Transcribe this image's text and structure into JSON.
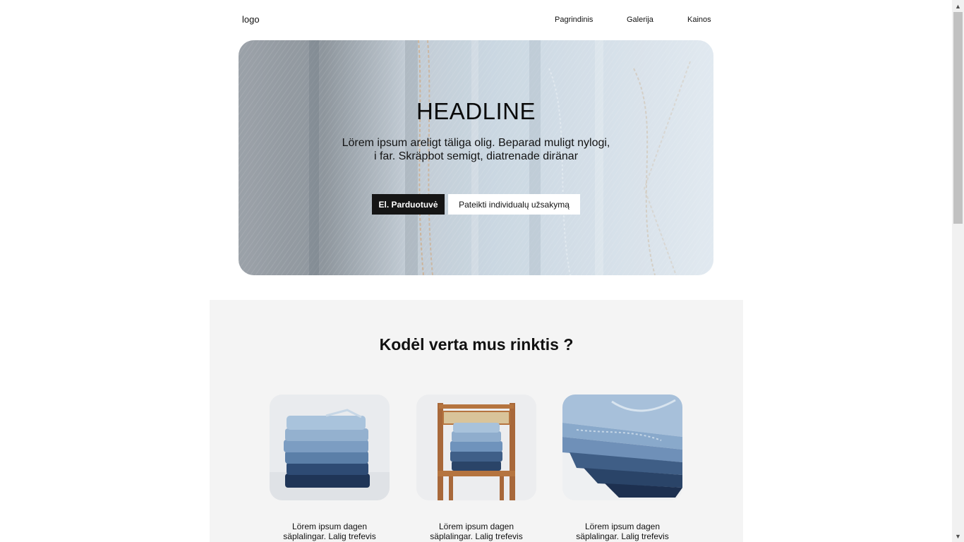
{
  "header": {
    "logo": "logo",
    "nav": [
      "Pagrindinis",
      "Galerija",
      "Kainos"
    ]
  },
  "hero": {
    "title": "HEADLINE",
    "subtitle": "Lörem ipsum areligt täliga olig. Beparad muligt nylogi, i far. Skräpbot semigt, diatrenade diränar",
    "primary_button": "El. Parduotuvė",
    "secondary_button": "Pateikti individualų užsakymą"
  },
  "features": {
    "title": "Kodėl verta mus rinktis ?",
    "cards": [
      {
        "image": "folded-jeans-stack-photo",
        "text_line1": "Lörem ipsum dagen",
        "text_line2": "säplalingar. Lalig trefevis"
      },
      {
        "image": "jeans-on-chair-photo",
        "text_line1": "Lörem ipsum dagen",
        "text_line2": "säplalingar. Lalig trefevis"
      },
      {
        "image": "jeans-pile-closeup-photo",
        "text_line1": "Lörem ipsum dagen",
        "text_line2": "säplalingar. Lalig trefevis"
      }
    ]
  },
  "scrollbar": {
    "up_icon": "▲",
    "down_icon": "▼"
  },
  "colors": {
    "dark_button": "#151515",
    "section_bg": "#f4f4f4",
    "denim_light": "#a9c3d8",
    "denim_dark": "#2c4a70"
  }
}
